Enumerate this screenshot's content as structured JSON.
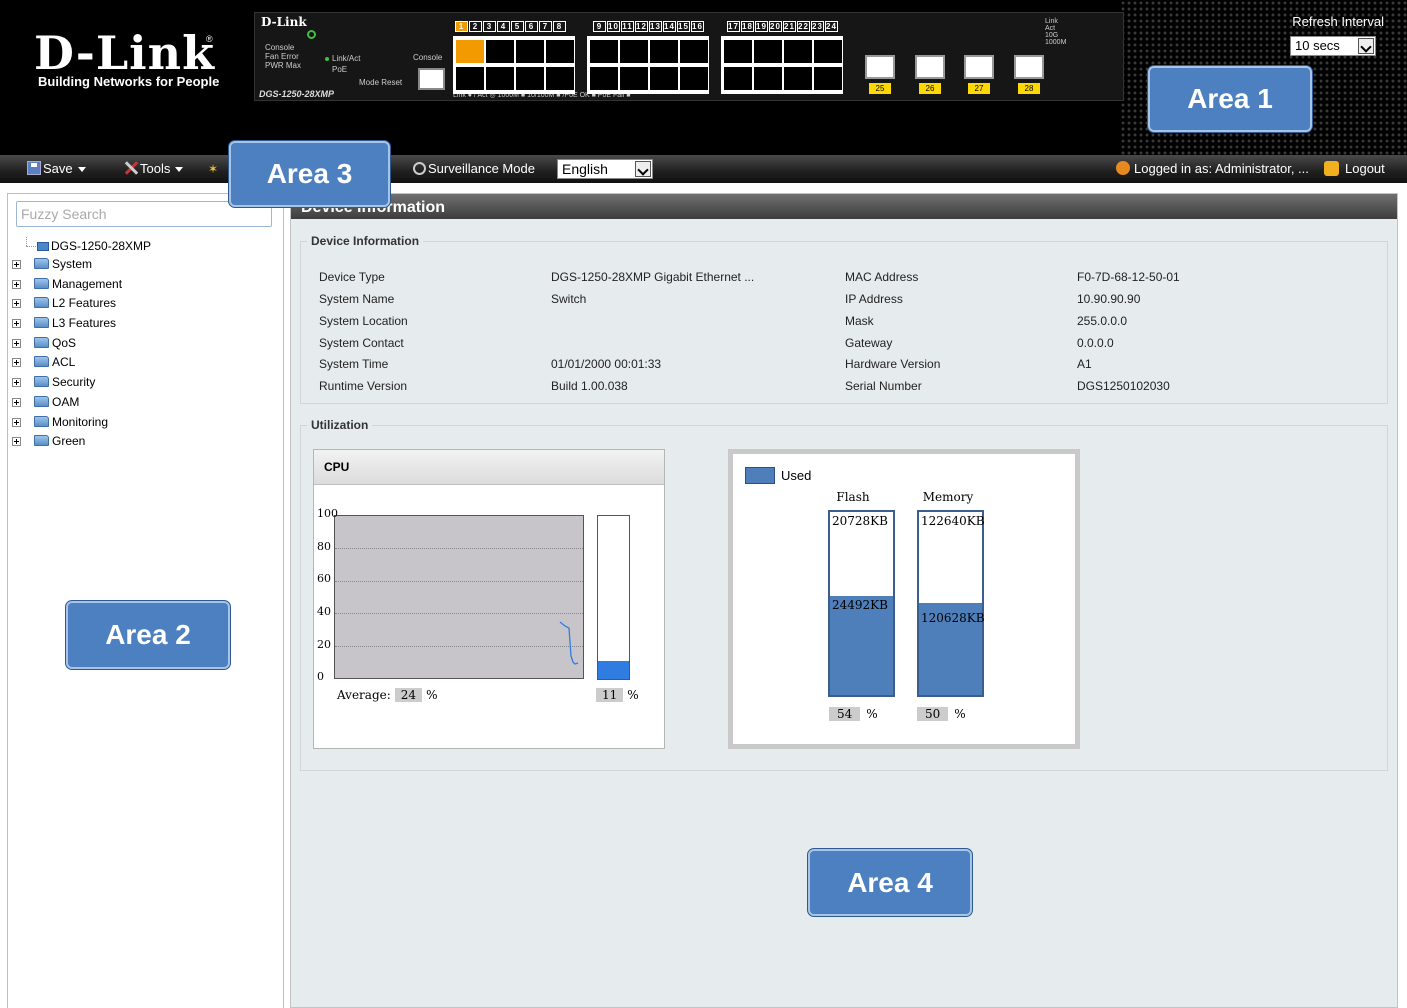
{
  "header": {
    "logo_name": "D-Link",
    "logo_tagline": "Building Networks for People",
    "panel_brand": "D-Link",
    "panel_model": "DGS-1250-28XMP",
    "panel_led_labels": [
      "Console",
      "Fan Error",
      "PWR Max"
    ],
    "panel_linkact_labels": [
      "Link/Act",
      "PoE"
    ],
    "panel_mode_reset": "Mode Reset",
    "panel_console_label": "Console",
    "panel_bottom_legend": "Link ● / Act ◎  1000M ■  10/100M ■  /PoE OK ■  PoE Fail ■",
    "port_numbers_group1": [
      "1",
      "2",
      "3",
      "4",
      "5",
      "6",
      "7",
      "8"
    ],
    "port_numbers_group2": [
      "9",
      "10",
      "11",
      "12",
      "13",
      "14",
      "15",
      "16"
    ],
    "port_numbers_group3": [
      "17",
      "18",
      "19",
      "20",
      "21",
      "22",
      "23",
      "24"
    ],
    "sfp_ports": [
      "25",
      "26",
      "27",
      "28"
    ],
    "led_legend": [
      "Link",
      "Act",
      "10G",
      "1000M"
    ],
    "refresh_interval_label": "Refresh Interval",
    "refresh_interval_value": "10 secs"
  },
  "toolbar": {
    "save_label": "Save",
    "tools_label": "Tools",
    "surveillance_label": "Surveillance Mode",
    "language_value": "English",
    "logged_in_label": "Logged in as: Administrator, ...",
    "logout_label": "Logout"
  },
  "area_labels": {
    "area1": "Area 1",
    "area2": "Area 2",
    "area3": "Area 3",
    "area4": "Area 4"
  },
  "sidebar": {
    "search_placeholder": "Fuzzy Search",
    "root_label": "DGS-1250-28XMP",
    "items": [
      {
        "label": "System"
      },
      {
        "label": "Management"
      },
      {
        "label": "L2 Features"
      },
      {
        "label": "L3 Features"
      },
      {
        "label": "QoS"
      },
      {
        "label": "ACL"
      },
      {
        "label": "Security"
      },
      {
        "label": "OAM"
      },
      {
        "label": "Monitoring"
      },
      {
        "label": "Green"
      }
    ]
  },
  "content": {
    "title": "Device Information",
    "device_info_legend": "Device Information",
    "device_info": {
      "left": [
        {
          "label": "Device Type",
          "value": "DGS-1250-28XMP Gigabit Ethernet ..."
        },
        {
          "label": "System Name",
          "value": "Switch"
        },
        {
          "label": "System Location",
          "value": ""
        },
        {
          "label": "System Contact",
          "value": ""
        },
        {
          "label": "System Time",
          "value": "01/01/2000 00:01:33"
        },
        {
          "label": "Runtime Version",
          "value": "Build 1.00.038"
        }
      ],
      "right": [
        {
          "label": "MAC Address",
          "value": "F0-7D-68-12-50-01"
        },
        {
          "label": "IP Address",
          "value": "10.90.90.90"
        },
        {
          "label": "Mask",
          "value": "255.0.0.0"
        },
        {
          "label": "Gateway",
          "value": "0.0.0.0"
        },
        {
          "label": "Hardware Version",
          "value": "A1"
        },
        {
          "label": "Serial Number",
          "value": "DGS1250102030"
        }
      ]
    },
    "utilization_legend": "Utilization",
    "cpu": {
      "title": "CPU",
      "y_ticks": [
        "100",
        "80",
        "60",
        "40",
        "20",
        "0"
      ],
      "average_label": "Average:",
      "average_value": "24",
      "current_value": "11",
      "current_fraction": 0.11,
      "percent_sign": "%"
    },
    "memory": {
      "legend_used": "Used",
      "flash": {
        "title": "Flash",
        "total": "20728KB",
        "used": "24492KB",
        "percent": "54",
        "fraction": 0.54
      },
      "memory": {
        "title": "Memory",
        "total": "122640KB",
        "used": "120628KB",
        "percent": "50",
        "fraction": 0.5
      },
      "percent_sign": "%"
    }
  },
  "colors": {
    "header_bg": "#000000",
    "area_label_bg": "#4d80c0",
    "used_bar": "#4f7fbb",
    "cpu_bar": "#2f7de1",
    "content_bg": "#e6ecee"
  }
}
